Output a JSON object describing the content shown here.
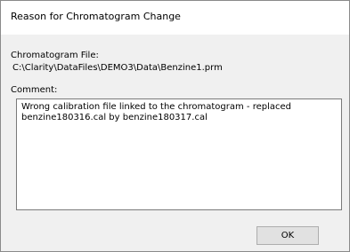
{
  "window": {
    "title": "Reason for Chromatogram Change"
  },
  "chromatogram_file": {
    "label": "Chromatogram File:",
    "path": "C:\\Clarity\\DataFiles\\DEMO3\\Data\\Benzine1.prm"
  },
  "comment": {
    "label": "Comment:",
    "value": "Wrong calibration file linked to the chromatogram - replaced benzine180316.cal by benzine180317.cal"
  },
  "buttons": {
    "ok_label": "OK"
  }
}
